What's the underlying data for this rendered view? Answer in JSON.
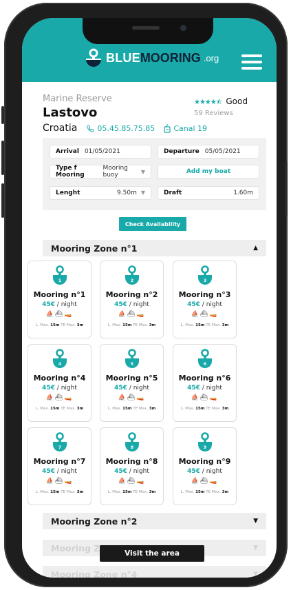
{
  "header": {
    "logo_blue": "BLUE",
    "logo_mooring": "MOORING",
    "logo_org": ".org"
  },
  "place": {
    "category": "Marine Reserve",
    "name": "Lastovo",
    "country": "Croatia",
    "phone": "05.45.85.75.85",
    "channel": "Canal 19"
  },
  "rating": {
    "stars": "★★★★⯪",
    "label": "Good",
    "reviews": "59 Reviews"
  },
  "booking": {
    "arrival_label": "Arrival",
    "arrival_value": "01/05/2021",
    "departure_label": "Departure",
    "departure_value": "05/05/2021",
    "mooring_type_label": "Type f Mooring",
    "mooring_type_value": "Mooring buoy",
    "add_boat_label": "Add my boat",
    "length_label": "Lenght",
    "length_value": "9.50m",
    "draft_label": "Draft",
    "draft_value": "1.60m",
    "check_button": "Check Availability"
  },
  "zones": [
    {
      "label": "Mooring Zone n°1",
      "arrow": "▲"
    },
    {
      "label": "Mooring Zone n°2",
      "arrow": "▼"
    },
    {
      "label": "Mooring Zone n°3",
      "arrow": "▼"
    },
    {
      "label": "Mooring Zone n°4",
      "arrow": "▼"
    }
  ],
  "moorings": [
    {
      "num": "1",
      "name": "Mooring n°1",
      "price": "45€",
      "unit": " / night",
      "lmax_label": "L. Max.",
      "lmax": "15m",
      "te_label": "TE Max.",
      "te": "3m"
    },
    {
      "num": "2",
      "name": "Mooring n°2",
      "price": "45€",
      "unit": " / night",
      "lmax_label": "L. Max.",
      "lmax": "15m",
      "te_label": "TE Max.",
      "te": "3m"
    },
    {
      "num": "3",
      "name": "Mooring n°3",
      "price": "45€",
      "unit": " / night",
      "lmax_label": "L. Max.",
      "lmax": "15m",
      "te_label": "TE Max.",
      "te": "3m"
    },
    {
      "num": "4",
      "name": "Mooring n°4",
      "price": "45€",
      "unit": " / night",
      "lmax_label": "L. Max.",
      "lmax": "15m",
      "te_label": "TE Max.",
      "te": "3m"
    },
    {
      "num": "5",
      "name": "Mooring n°5",
      "price": "45€",
      "unit": " / night",
      "lmax_label": "L. Max.",
      "lmax": "15m",
      "te_label": "TE Max.",
      "te": "3m"
    },
    {
      "num": "6",
      "name": "Mooring n°6",
      "price": "45€",
      "unit": " / night",
      "lmax_label": "L. Max.",
      "lmax": "15m",
      "te_label": "TE Max.",
      "te": "3m"
    },
    {
      "num": "7",
      "name": "Mooring n°7",
      "price": "45€",
      "unit": " / night",
      "lmax_label": "L. Max.",
      "lmax": "15m",
      "te_label": "TE Max.",
      "te": "3m"
    },
    {
      "num": "8",
      "name": "Mooring n°8",
      "price": "45€",
      "unit": " / night",
      "lmax_label": "L. Max.",
      "lmax": "15m",
      "te_label": "TE Max.",
      "te": "3m"
    },
    {
      "num": "9",
      "name": "Mooring n°9",
      "price": "45€",
      "unit": " / night",
      "lmax_label": "L. Max.",
      "lmax": "15m",
      "te_label": "TE Max.",
      "te": "3m"
    }
  ],
  "toast": "Visit the area",
  "colors": {
    "accent": "#18a9a8",
    "navy": "#0e2238"
  }
}
